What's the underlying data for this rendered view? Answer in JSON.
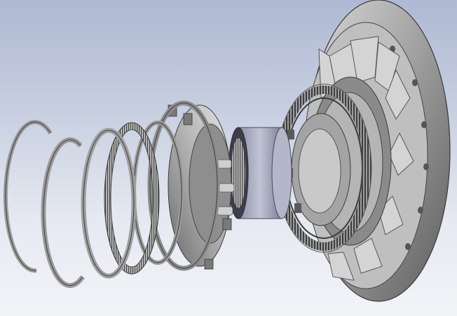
{
  "scene": {
    "kind": "exploded-assembly-render",
    "background_top": "#aeb9d3",
    "background_bottom": "#f3f4f8",
    "part_color": "#9a9a9a",
    "part_shadow": "#4a4a4a",
    "bearing_color": "#a9acc0",
    "parts": [
      {
        "name": "snap-ring-outer"
      },
      {
        "name": "snap-ring-inner"
      },
      {
        "name": "thrust-washer"
      },
      {
        "name": "thrust-needle-bearing"
      },
      {
        "name": "spacer-ring"
      },
      {
        "name": "backing-plate"
      },
      {
        "name": "planet-carrier"
      },
      {
        "name": "bearing-sleeve"
      },
      {
        "name": "ring-gear"
      },
      {
        "name": "stator-housing"
      }
    ]
  }
}
